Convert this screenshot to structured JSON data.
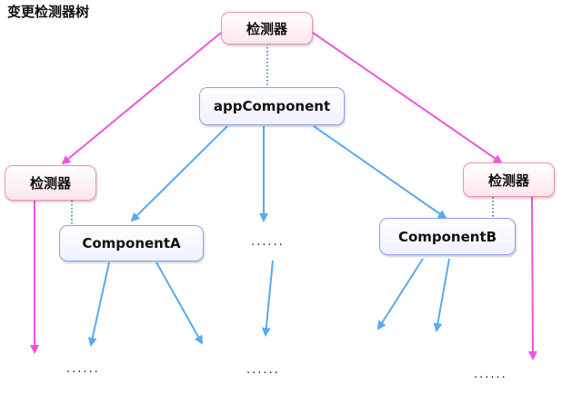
{
  "page": {
    "title": "变更检测器树"
  },
  "colors": {
    "detector_edge": "#ee55dd",
    "component_edge": "#5aaaf0",
    "link_dotted": "#5b8fc8",
    "detector_border": "#ef8fb2",
    "component_border": "#8d9ef2"
  },
  "nodes": {
    "detector_root": "检测器",
    "app_component": "appComponent",
    "detector_left": "检测器",
    "detector_right": "检测器",
    "component_a": "ComponentA",
    "component_b": "ComponentB"
  },
  "ellipses": {
    "middle": "......",
    "bottom_left": "......",
    "bottom_middle": "......",
    "bottom_right": "......"
  }
}
